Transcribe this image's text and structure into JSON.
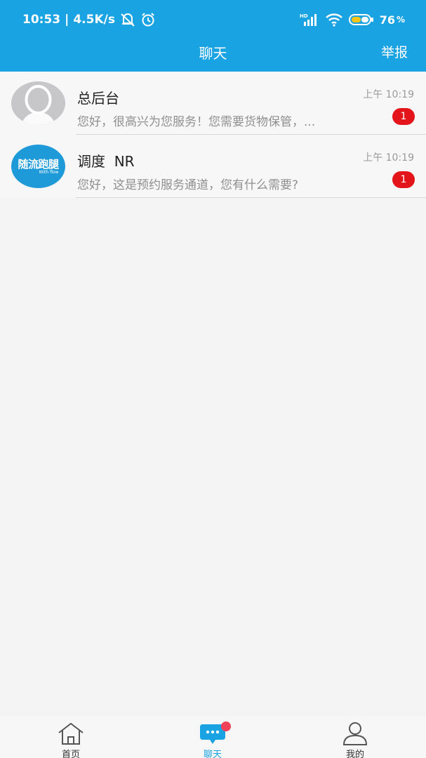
{
  "status_bar": {
    "time": "10:53",
    "speed": "4.5K/s",
    "battery": "76"
  },
  "header": {
    "title": "聊天",
    "report_label": "举报"
  },
  "conversations": [
    {
      "name": "总后台",
      "time": "上午 10:19",
      "preview": "您好，很高兴为您服务！您需要货物保管，...",
      "unread": "1",
      "avatar": "default-user-icon"
    },
    {
      "name": "调度  NR",
      "time": "上午 10:19",
      "preview": "您好，这是预约服务通道，您有什么需要?",
      "unread": "1",
      "avatar": "brand-logo",
      "avatar_text": "随流跑腿",
      "avatar_subtext": "With flow"
    }
  ],
  "tabs": [
    {
      "label": "首页",
      "icon": "home-icon"
    },
    {
      "label": "聊天",
      "icon": "chat-icon"
    },
    {
      "label": "我的",
      "icon": "user-icon"
    }
  ],
  "colors": {
    "primary": "#1aa3e3",
    "badge": "#e4151a",
    "notice_dot": "#f0405a"
  }
}
